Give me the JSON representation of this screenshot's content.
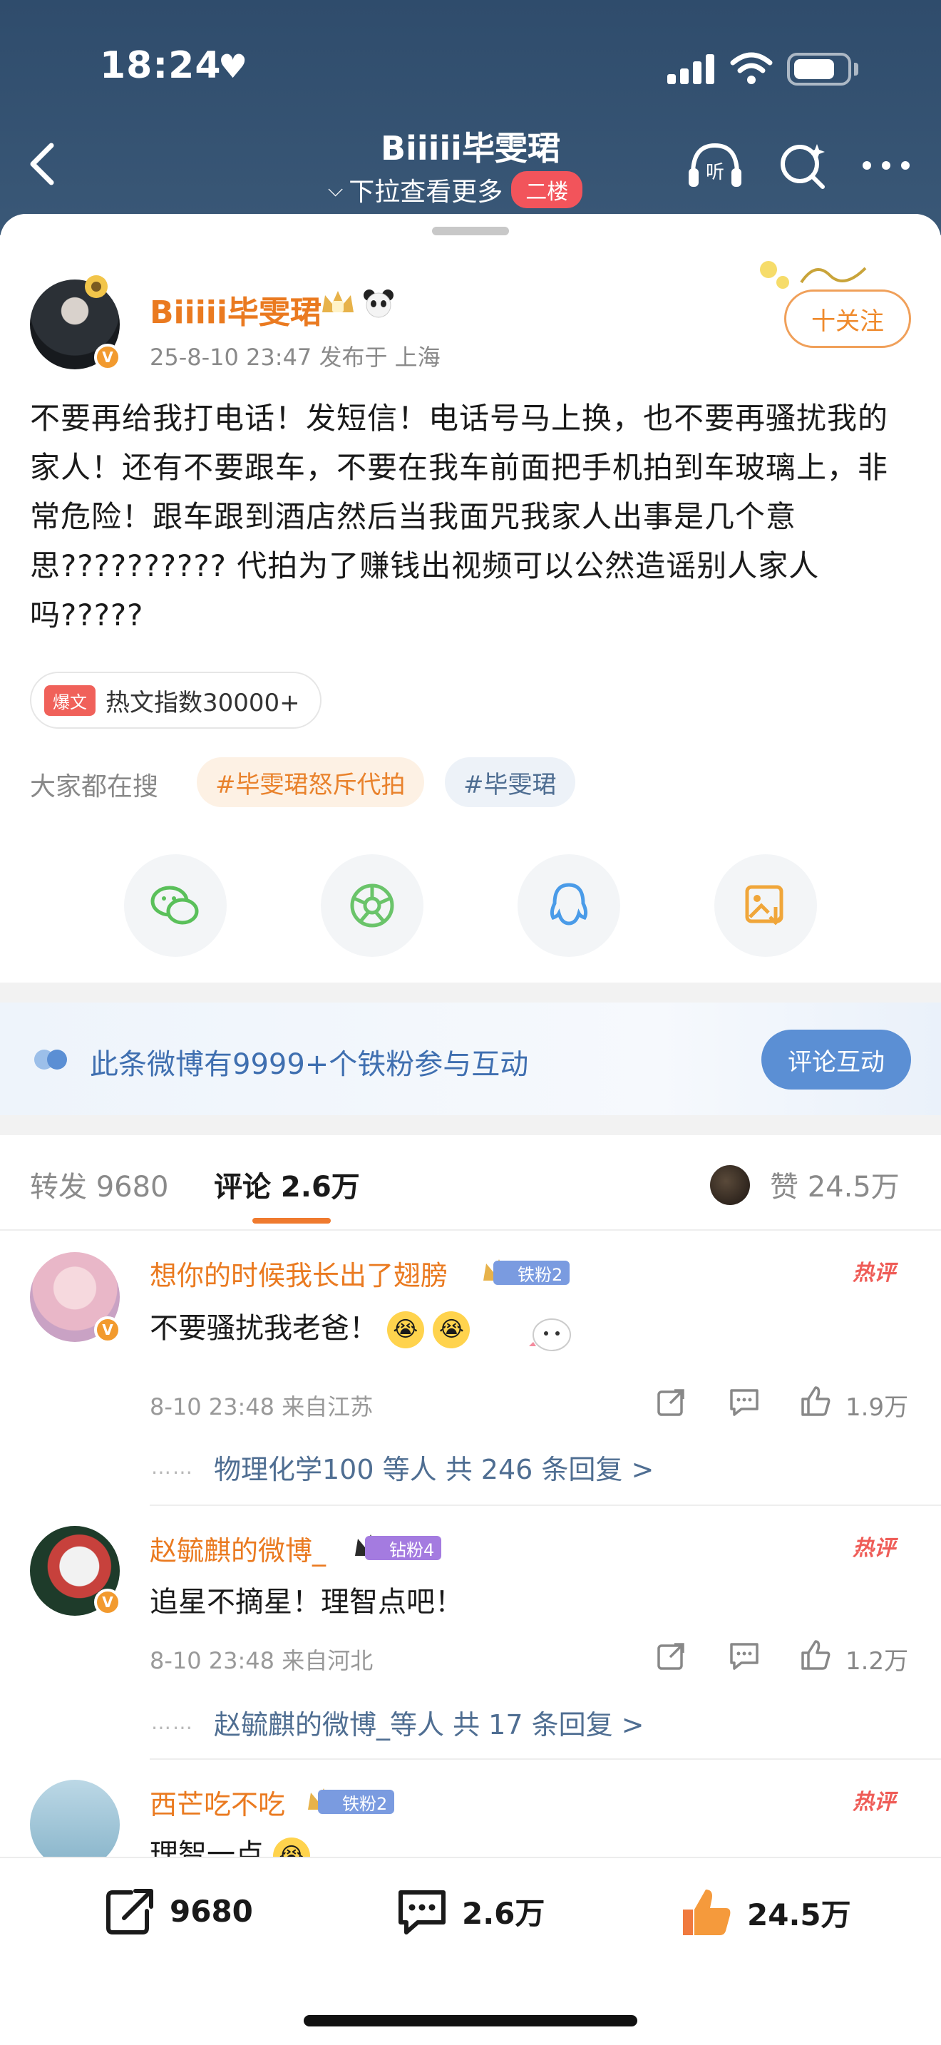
{
  "status_bar": {
    "time": "18:24",
    "heart": "♥"
  },
  "nav": {
    "title": "Biiiii毕雯珺",
    "subtitle": "下拉查看更多",
    "floor_badge": "二楼",
    "listen_label": "听"
  },
  "post": {
    "author": "Biiiii毕雯珺",
    "meta": "25-8-10 23:47  发布于 上海",
    "follow_label": "十关注",
    "body": "不要再给我打电话！发短信！电话号马上换，也不要再骚扰我的家人！还有不要跟车，不要在我车前面把手机拍到车玻璃上，非常危险！跟车跟到酒店然后当我面咒我家人出事是几个意思?????????? 代拍为了赚钱出视频可以公然造谣别人家人吗?????",
    "hot_tag": "爆文",
    "hot_index": "热文指数30000+",
    "search_label": "大家都在搜",
    "search_chips": [
      "#毕雯珺怒斥代拍",
      "#毕雯珺"
    ]
  },
  "share_icons": [
    "wechat-icon",
    "moments-icon",
    "qq-icon",
    "save-image-icon"
  ],
  "fan_banner": {
    "text": "此条微博有9999+个铁粉参与互动",
    "button": "评论互动"
  },
  "tabs": {
    "repost": "转发 9680",
    "comment": "评论 2.6万",
    "like": "赞 24.5万"
  },
  "comments": [
    {
      "name": "想你的时候我长出了翅膀",
      "badge": "铁粉2",
      "hot": "热评",
      "text": "不要骚扰我老爸！",
      "meta": "8-10 23:48  来自江苏",
      "likes": "1.9万",
      "replies": "物理化学100 等人  共 246 条回复 >"
    },
    {
      "name": "赵毓麒的微博_",
      "badge": "钻粉4",
      "hot": "热评",
      "text": "追星不摘星！理智点吧！",
      "meta": "8-10 23:48  来自河北",
      "likes": "1.2万",
      "replies": "赵毓麒的微博_等人  共 17 条回复 >"
    },
    {
      "name": "西芒吃不吃",
      "badge": "铁粉2",
      "hot": "热评",
      "text": "理智一点"
    }
  ],
  "bottom_bar": {
    "repost": "9680",
    "comment": "2.6万",
    "like": "24.5万"
  },
  "colors": {
    "header_bg": "#2f4c6c",
    "accent_orange": "#ea7a20",
    "link_blue": "#4f6e92",
    "fan_button": "#5b8fd4",
    "hot_red": "#ef5d58"
  }
}
